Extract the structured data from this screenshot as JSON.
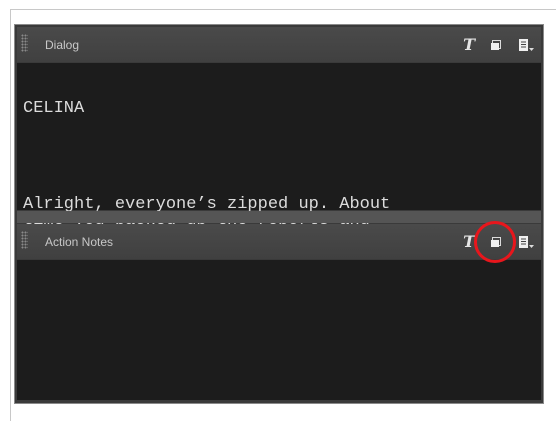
{
  "dialog_panel": {
    "title": "Dialog",
    "character": "CELINA",
    "line": "Alright, everyone’s zipped up. About\ntime you packed up the reports and\ncaught some theta waves too.",
    "icons": [
      "text-format-icon",
      "maximize-icon",
      "notes-menu-icon"
    ]
  },
  "action_notes_panel": {
    "title": "Action Notes",
    "content": "",
    "icons": [
      "text-format-icon",
      "maximize-icon",
      "notes-menu-icon"
    ]
  },
  "colors": {
    "panel_bg": "#3a3a3a",
    "header_bg": "#444444",
    "text_area_bg": "#1c1c1c",
    "highlight": "#e8161c"
  }
}
